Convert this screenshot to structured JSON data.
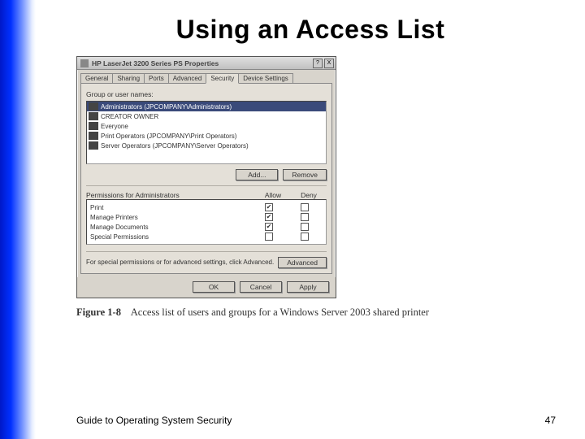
{
  "slide": {
    "title": "Using an Access List",
    "footer_text": "Guide to Operating System Security",
    "page_number": "47"
  },
  "figure": {
    "label": "Figure 1-8",
    "caption": "Access list of users and groups for a Windows Server 2003 shared printer"
  },
  "window": {
    "title": "HP LaserJet 3200 Series PS Properties",
    "help_glyph": "?",
    "close_glyph": "X"
  },
  "tabs": [
    "General",
    "Sharing",
    "Ports",
    "Advanced",
    "Security",
    "Device Settings"
  ],
  "active_tab_index": 4,
  "security": {
    "group_label": "Group or user names:",
    "groups": [
      {
        "text": "Administrators (JPCOMPANY\\Administrators)",
        "selected": true
      },
      {
        "text": "CREATOR OWNER",
        "selected": false
      },
      {
        "text": "Everyone",
        "selected": false
      },
      {
        "text": "Print Operators (JPCOMPANY\\Print Operators)",
        "selected": false
      },
      {
        "text": "Server Operators (JPCOMPANY\\Server Operators)",
        "selected": false
      }
    ],
    "add_label": "Add...",
    "remove_label": "Remove",
    "perm_for_label": "Permissions for Administrators",
    "col_allow": "Allow",
    "col_deny": "Deny",
    "permissions": [
      {
        "name": "Print",
        "allow": true,
        "deny": false
      },
      {
        "name": "Manage Printers",
        "allow": true,
        "deny": false
      },
      {
        "name": "Manage Documents",
        "allow": true,
        "deny": false
      },
      {
        "name": "Special Permissions",
        "allow": false,
        "deny": false
      }
    ],
    "adv_text": "For special permissions or for advanced settings, click Advanced.",
    "adv_button": "Advanced"
  },
  "dialog_buttons": {
    "ok": "OK",
    "cancel": "Cancel",
    "apply": "Apply"
  }
}
